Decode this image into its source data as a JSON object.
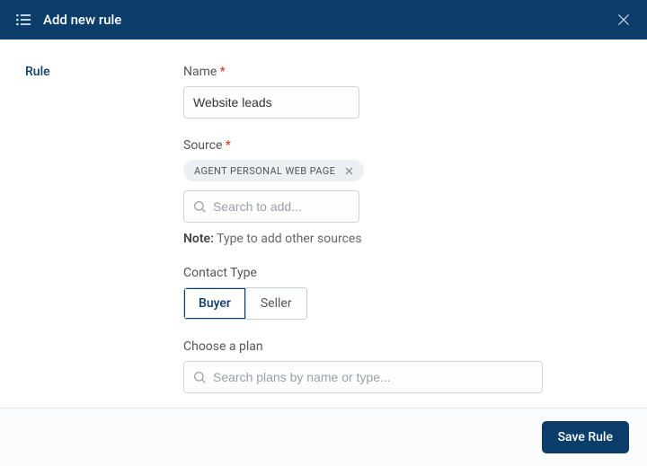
{
  "header": {
    "title": "Add new rule"
  },
  "left": {
    "label": "Rule"
  },
  "form": {
    "name": {
      "label": "Name",
      "value": "Website leads"
    },
    "source": {
      "label": "Source",
      "chip": "AGENT PERSONAL WEB PAGE",
      "search_placeholder": "Search to add...",
      "note_bold": "Note:",
      "note_text": " Type to add other sources"
    },
    "contact_type": {
      "label": "Contact Type",
      "options": [
        "Buyer",
        "Seller"
      ],
      "selected": "Buyer"
    },
    "plan": {
      "label": "Choose a plan",
      "search_placeholder": "Search plans by name or type..."
    }
  },
  "footer": {
    "save_label": "Save Rule"
  }
}
